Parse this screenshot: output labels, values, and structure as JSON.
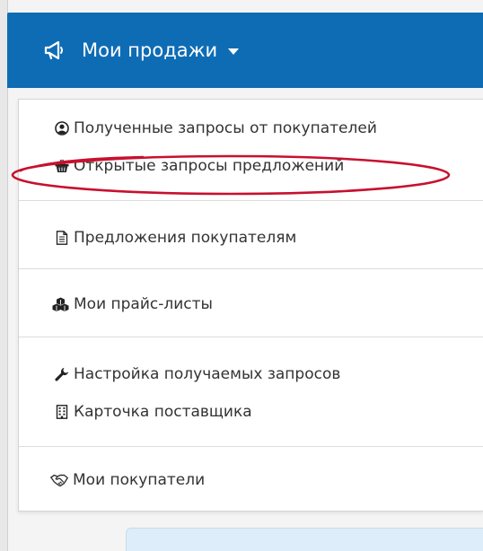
{
  "nav": {
    "title": "Мои продажи",
    "icon": "megaphone-icon",
    "bg_color": "#0e6cb5"
  },
  "menu": {
    "groups": [
      {
        "items": [
          {
            "label": "Полученные запросы от покупателей",
            "icon": "user-circle-icon"
          },
          {
            "label": "Открытые запросы предложений",
            "icon": "basket-icon",
            "highlighted": true
          }
        ]
      },
      {
        "items": [
          {
            "label": "Предложения покупателям",
            "icon": "document-icon"
          }
        ]
      },
      {
        "items": [
          {
            "label": "Мои прайс-листы",
            "icon": "cubes-icon"
          }
        ]
      },
      {
        "items": [
          {
            "label": "Настройка получаемых запросов",
            "icon": "wrench-icon"
          },
          {
            "label": "Карточка поставщика",
            "icon": "building-icon"
          }
        ]
      },
      {
        "items": [
          {
            "label": "Мои покупатели",
            "icon": "handshake-icon"
          }
        ]
      }
    ]
  },
  "highlight_color": "#c8102e"
}
